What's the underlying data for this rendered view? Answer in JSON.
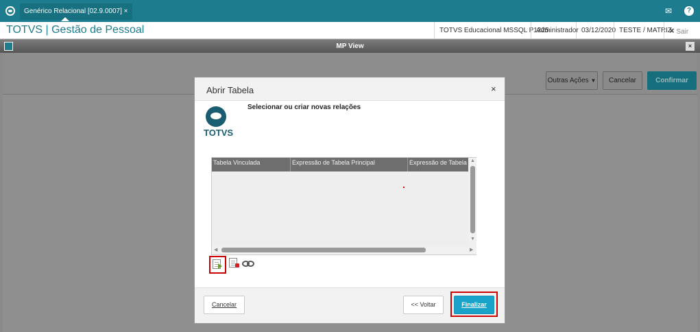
{
  "app": {
    "tab_title": "Genérico Relacional [02.9.0007]",
    "tab_close": "×",
    "brand": "TOTVS | Gestão de Pessoal",
    "colors": {
      "teal": "#1d7d8e",
      "primary_button": "#1aa3c8",
      "highlight": "#cc0000"
    }
  },
  "header": {
    "environment": "TOTVS Educacional MSSQL P1225",
    "user": "Administrador",
    "date": "03/12/2020",
    "company": "TESTE / MATRIZ",
    "exit_label": "Sair",
    "exit_icon": "×"
  },
  "topbar_icons": {
    "mail": "✉",
    "help": "?"
  },
  "window": {
    "title": "MP View",
    "close": "×"
  },
  "background_actions": {
    "more_actions": "Outras Ações",
    "cancel": "Cancelar",
    "confirm": "Confirmar"
  },
  "modal": {
    "title": "Abrir Tabela",
    "close": "×",
    "logo_text": "TOTVS",
    "heading": "Selecionar ou criar novas relações",
    "grid": {
      "columns": [
        "Tabela Vinculada",
        "Expressão de Tabela Principal",
        "Expressão de Tabela Re"
      ],
      "rows": []
    },
    "toolbar_icons": [
      "add-relation-icon",
      "remove-relation-icon",
      "link-icon"
    ],
    "buttons": {
      "cancel": "Cancelar",
      "back": "<< Voltar",
      "finish": "Finalizar"
    }
  }
}
